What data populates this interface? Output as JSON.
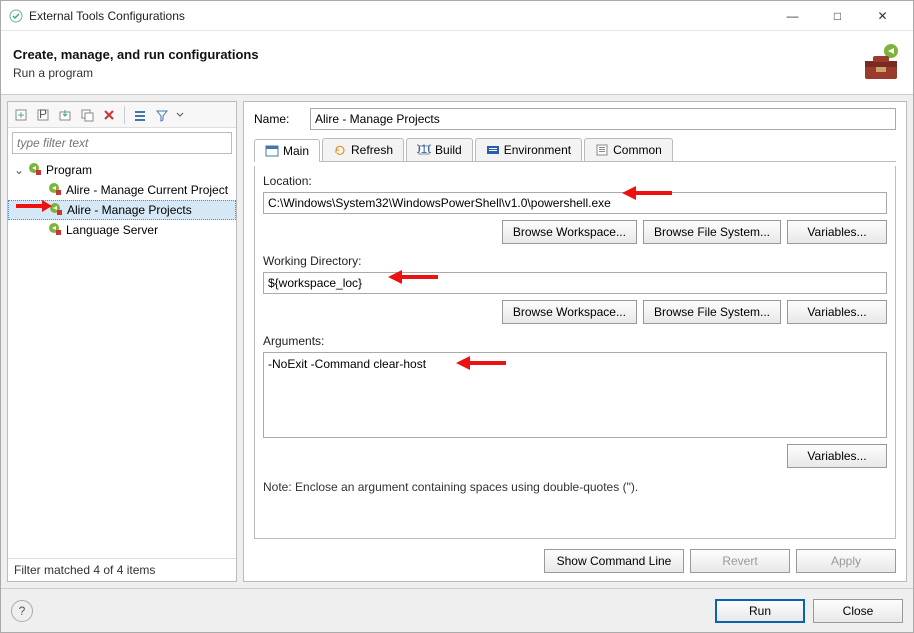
{
  "window": {
    "title": "External Tools Configurations"
  },
  "header": {
    "title": "Create, manage, and run configurations",
    "subtitle": "Run a program"
  },
  "filter": {
    "placeholder": "type filter text"
  },
  "tree": {
    "root": "Program",
    "items": [
      {
        "label": "Alire - Manage Current Project"
      },
      {
        "label": "Alire - Manage Projects",
        "selected": true
      },
      {
        "label": "Language Server"
      }
    ],
    "status": "Filter matched 4 of 4 items"
  },
  "form": {
    "name_label": "Name:",
    "name_value": "Alire - Manage Projects",
    "tabs": {
      "main": "Main",
      "refresh": "Refresh",
      "build": "Build",
      "environment": "Environment",
      "common": "Common"
    },
    "location_label": "Location:",
    "location_value": "C:\\Windows\\System32\\WindowsPowerShell\\v1.0\\powershell.exe",
    "workdir_label": "Working Directory:",
    "workdir_value": "${workspace_loc}",
    "args_label": "Arguments:",
    "args_value": "-NoExit -Command clear-host",
    "buttons": {
      "browse_workspace": "Browse Workspace...",
      "browse_filesystem": "Browse File System...",
      "variables": "Variables...",
      "show_cmd": "Show Command Line",
      "revert": "Revert",
      "apply": "Apply"
    },
    "note": "Note: Enclose an argument containing spaces using double-quotes (\")."
  },
  "footer": {
    "run": "Run",
    "close": "Close"
  }
}
